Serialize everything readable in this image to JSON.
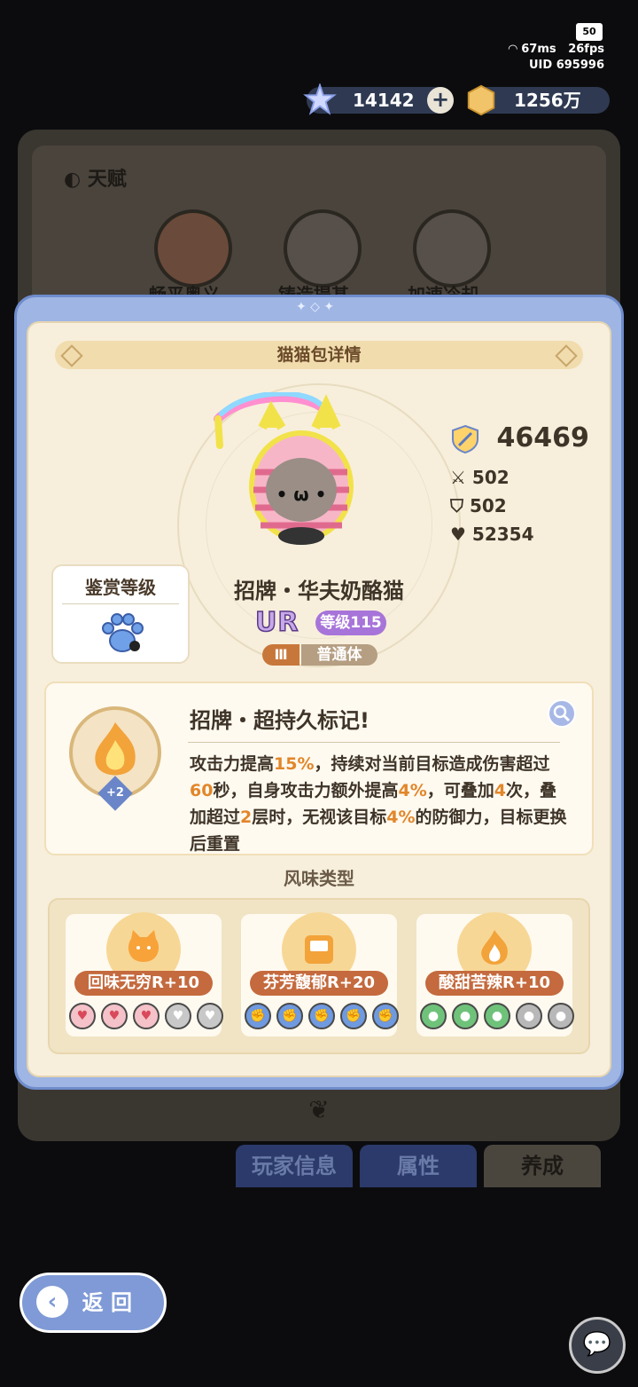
{
  "status": {
    "battery": "50",
    "ping": "67ms",
    "fps": "26fps",
    "uid_label": "UID",
    "uid": "695996"
  },
  "currency": {
    "gems": "14142",
    "gold": "1256万"
  },
  "background": {
    "talent_title": "天赋",
    "talents": [
      "畅平奥义",
      "铸造提甚",
      "加速冷却"
    ],
    "tabs": [
      "玩家信息",
      "属性",
      "养成"
    ]
  },
  "modal": {
    "title": "猫猫包详情",
    "power": "46469",
    "attack": "502",
    "defense": "502",
    "hp": "52354",
    "appreciation_label": "鉴赏等级",
    "cat_name": "招牌・华夫奶酪猫",
    "rarity": "UR",
    "level": "等级115",
    "tier": "Ⅲ",
    "body_type": "普通体",
    "skill": {
      "title": "招牌・超持久标记!",
      "badge": "+2",
      "desc_parts": [
        "攻击力提高",
        "15%",
        "，持续对当前目标造成伤害超过",
        "60",
        "秒，自身攻击力额外提高",
        "4%",
        "，可叠加",
        "4",
        "次，叠加超过",
        "2",
        "层时，无视该目标",
        "4%",
        "的防御力，目标更换后重置"
      ]
    },
    "flavor_title": "风味类型",
    "flavors": [
      {
        "label": "回味无穷R+10",
        "icon": "cat-face-icon"
      },
      {
        "label": "芬芳馥郁R+20",
        "icon": "box-icon"
      },
      {
        "label": "酸甜苦辣R+10",
        "icon": "flame-icon"
      }
    ]
  },
  "back_label": "返 回"
}
